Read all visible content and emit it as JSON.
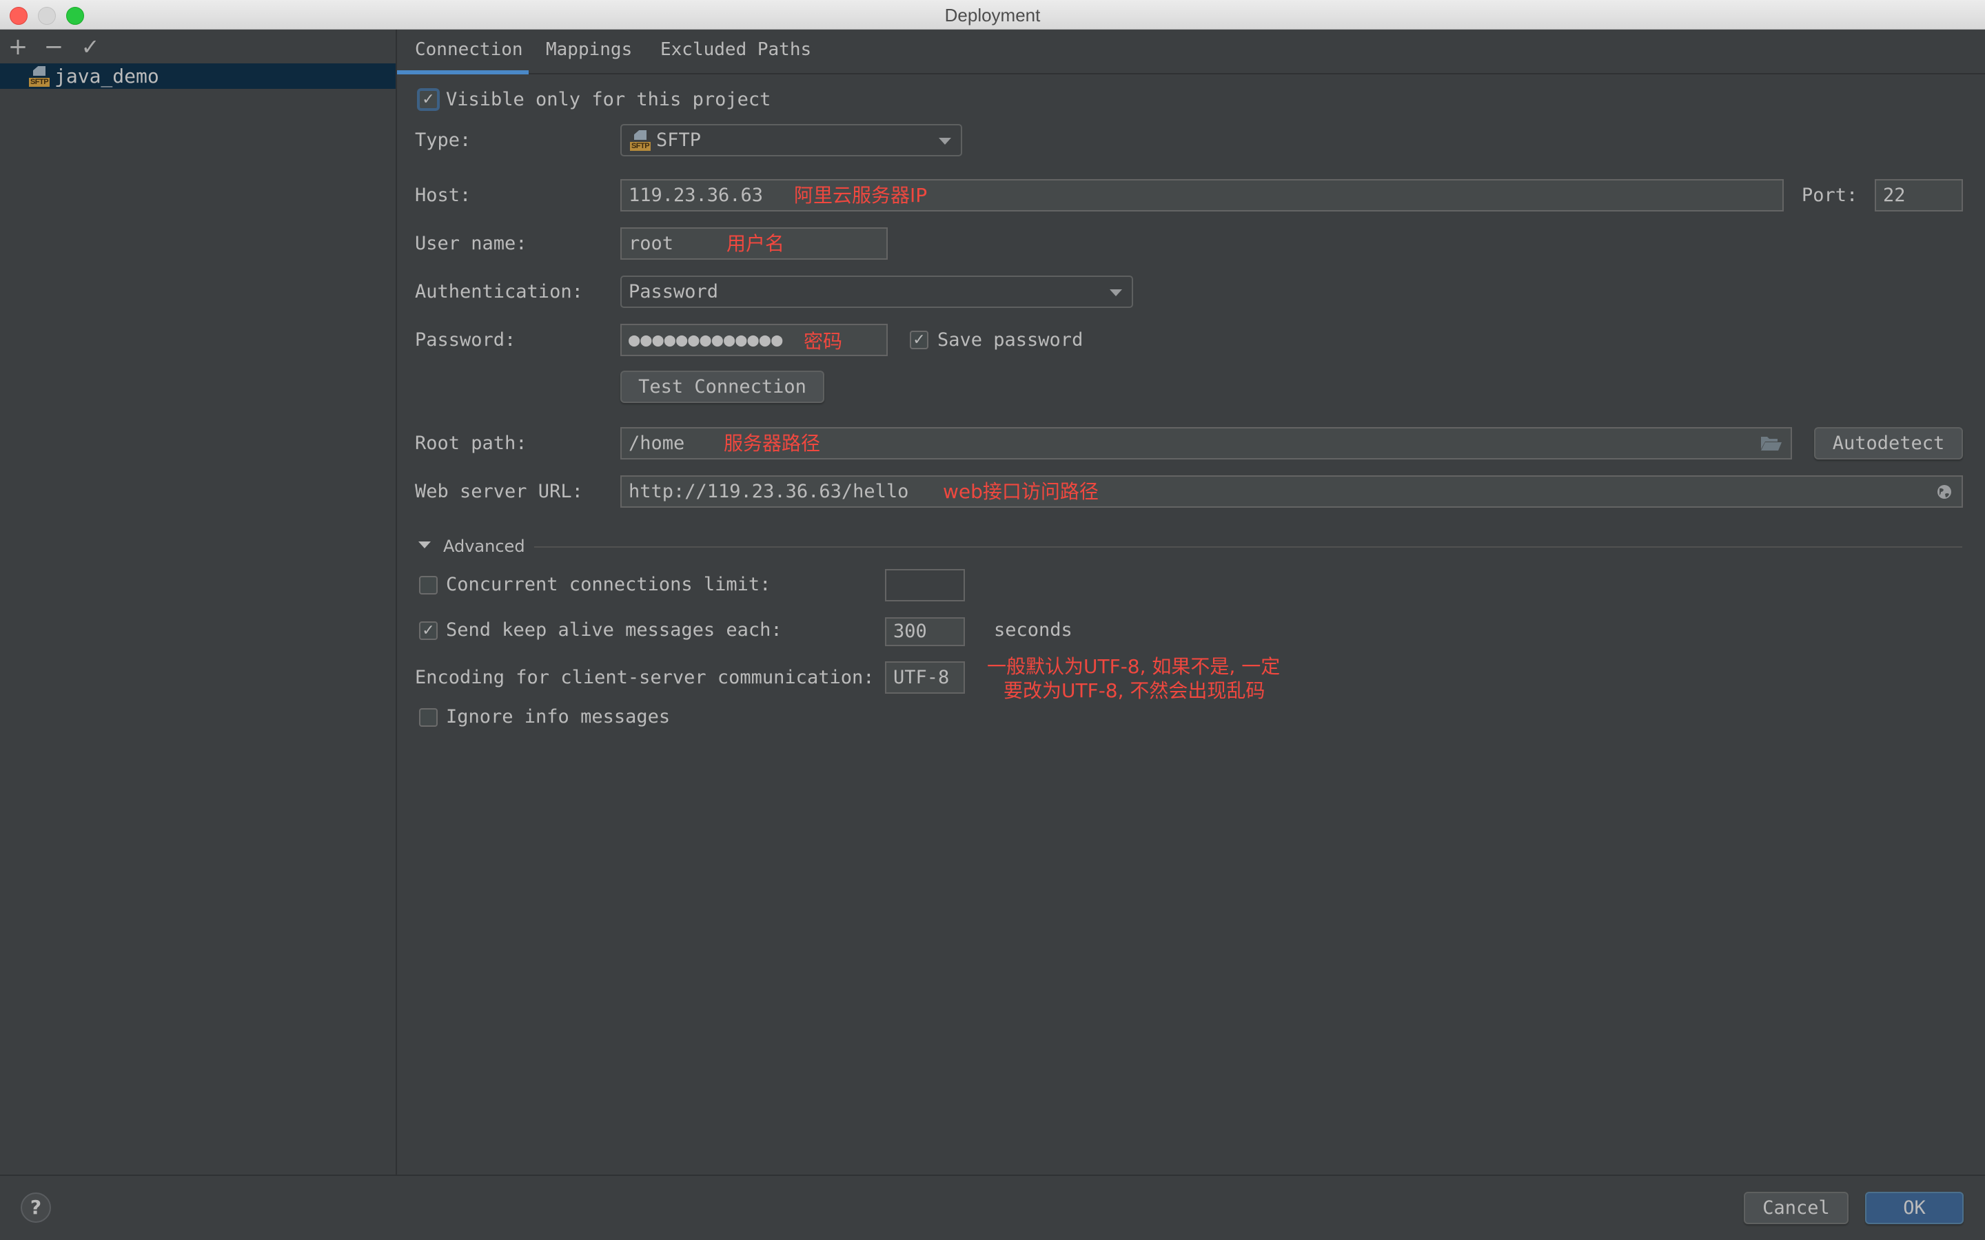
{
  "window": {
    "title": "Deployment",
    "traffic_lights": {
      "close": "#fe5f57",
      "minimize": "#d6d6d6",
      "maximize": "#28c840"
    }
  },
  "sidebar": {
    "toolbar": {
      "add_icon": "+",
      "remove_icon": "−",
      "apply_icon": "✓"
    },
    "servers": [
      {
        "name": "java_demo",
        "icon": "sftp-icon",
        "icon_tag": "SFTP",
        "selected": true
      }
    ]
  },
  "tabs": [
    {
      "label": "Connection",
      "active": true
    },
    {
      "label": "Mappings",
      "active": false
    },
    {
      "label": "Excluded Paths",
      "active": false
    }
  ],
  "connection": {
    "visible_only": {
      "label": "Visible only for this project",
      "checked": true,
      "mark": "✓"
    },
    "type": {
      "label": "Type:",
      "value": "SFTP",
      "icon_tag": "SFTP"
    },
    "host": {
      "label": "Host:",
      "value": "119.23.36.63",
      "note": "阿里云服务器IP"
    },
    "port": {
      "label": "Port:",
      "value": "22"
    },
    "username": {
      "label": "User name:",
      "value": "root",
      "note": "用户名"
    },
    "authentication": {
      "label": "Authentication:",
      "value": "Password"
    },
    "password": {
      "label": "Password:",
      "masked": "●●●●●●●●●●●●●",
      "note": "密码"
    },
    "save_password": {
      "label": "Save password",
      "checked": true,
      "mark": "✓"
    },
    "test_connection": {
      "label": "Test Connection"
    },
    "root_path": {
      "label": "Root path:",
      "value": "/home",
      "note": "服务器路径"
    },
    "autodetect": {
      "label": "Autodetect"
    },
    "web_url": {
      "label": "Web server URL:",
      "value": "http://119.23.36.63/hello",
      "note": "web接口访问路径"
    }
  },
  "advanced": {
    "title": "Advanced",
    "expanded": true,
    "concurrent_limit": {
      "label": "Concurrent connections limit:",
      "checked": false,
      "value": ""
    },
    "keep_alive": {
      "label": "Send keep alive messages each:",
      "checked": true,
      "mark": "✓",
      "value": "300",
      "unit": "seconds"
    },
    "encoding": {
      "label": "Encoding for client-server communication:",
      "value": "UTF-8",
      "note_line1": "一般默认为UTF-8, 如果不是, 一定",
      "note_line2": "要改为UTF-8, 不然会出现乱码"
    },
    "ignore_info": {
      "label": "Ignore info messages",
      "checked": false
    }
  },
  "footer": {
    "help": "?",
    "cancel": "Cancel",
    "ok": "OK"
  },
  "colors": {
    "background": "#3c3f41",
    "selection": "#0d293e",
    "accent": "#4a88c7",
    "primary_button": "#365880",
    "annotation": "#f0483f"
  }
}
